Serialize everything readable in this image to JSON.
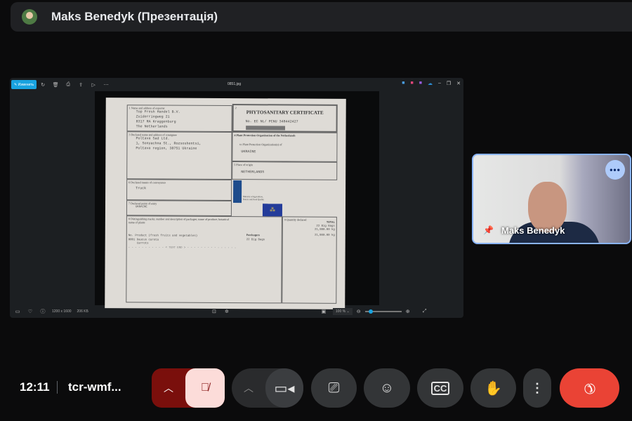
{
  "header": {
    "title": "Maks Benedyk (Презентація)"
  },
  "viewer": {
    "edit_label": "Изменить",
    "file_name": "0851.jpg",
    "dimensions": "1200 x 1600",
    "file_size": "206 KБ",
    "zoom": "100 %",
    "zoom_fraction": 0.1
  },
  "certificate": {
    "title": "PHYTOSANITARY CERTIFICATE",
    "number": "No. EC NL/ PCNU 348442427",
    "f1_label": "1  Name and address of exporter",
    "exporter": [
      "Top Fresh Handel B.V.",
      "Zuiderringweg 21",
      "8317 RA Kraggenburg",
      "The Netherlands"
    ],
    "f2_label": "2",
    "f3_label": "3  Declared name and address of consignee",
    "consignee": [
      "Poltava Sad Ltd.",
      "1, Sonyachna St., Rozsoshentsi,",
      "Poltava region, 38751 Ukraine"
    ],
    "f4_label": "4  Plant Protection Organization of the Netherlands",
    "f4_to": "to Plant Protection Organization(s) of",
    "f4_value": "UKRAINE",
    "f5_label": "5  Place of origin",
    "f5_value": "NETHERLANDS",
    "f6_label": "6  Declared means of conveyance",
    "f6_value": "Truck",
    "f7_label": "7  Declared point of entry",
    "f7_value": "UKRAINE",
    "f8_label": "8  Distinguishing marks; number and description of packages; name of produce; botanical name of plants",
    "f9_label": "9  Quantity declared",
    "total_label": "TOTAL",
    "total_bags": "22 Big Bags",
    "total_kg": "21,800.00 kg",
    "row_header": "No.   Product (fresh fruits and vegetables)",
    "packages_label": "Packages",
    "row": "0001 Daucus carota",
    "row2": "     Carrots",
    "row_packages": "22   Big Bags",
    "row_qty": "21,800.00 kg",
    "text_end": "- - - - - - - - - - - < TEXT END > - - - - - - - - - - - - - - -",
    "ministry": "Ministry of Agriculture, Nature and Food Quality"
  },
  "tile": {
    "name": "Maks Benedyk"
  },
  "footer": {
    "time": "12:11",
    "meeting_code": "tcr-wmf..."
  },
  "colors": {
    "mic_off_bg": "#fcdcd9",
    "end_call": "#ea4335",
    "tile_border": "#8ab4f8"
  }
}
